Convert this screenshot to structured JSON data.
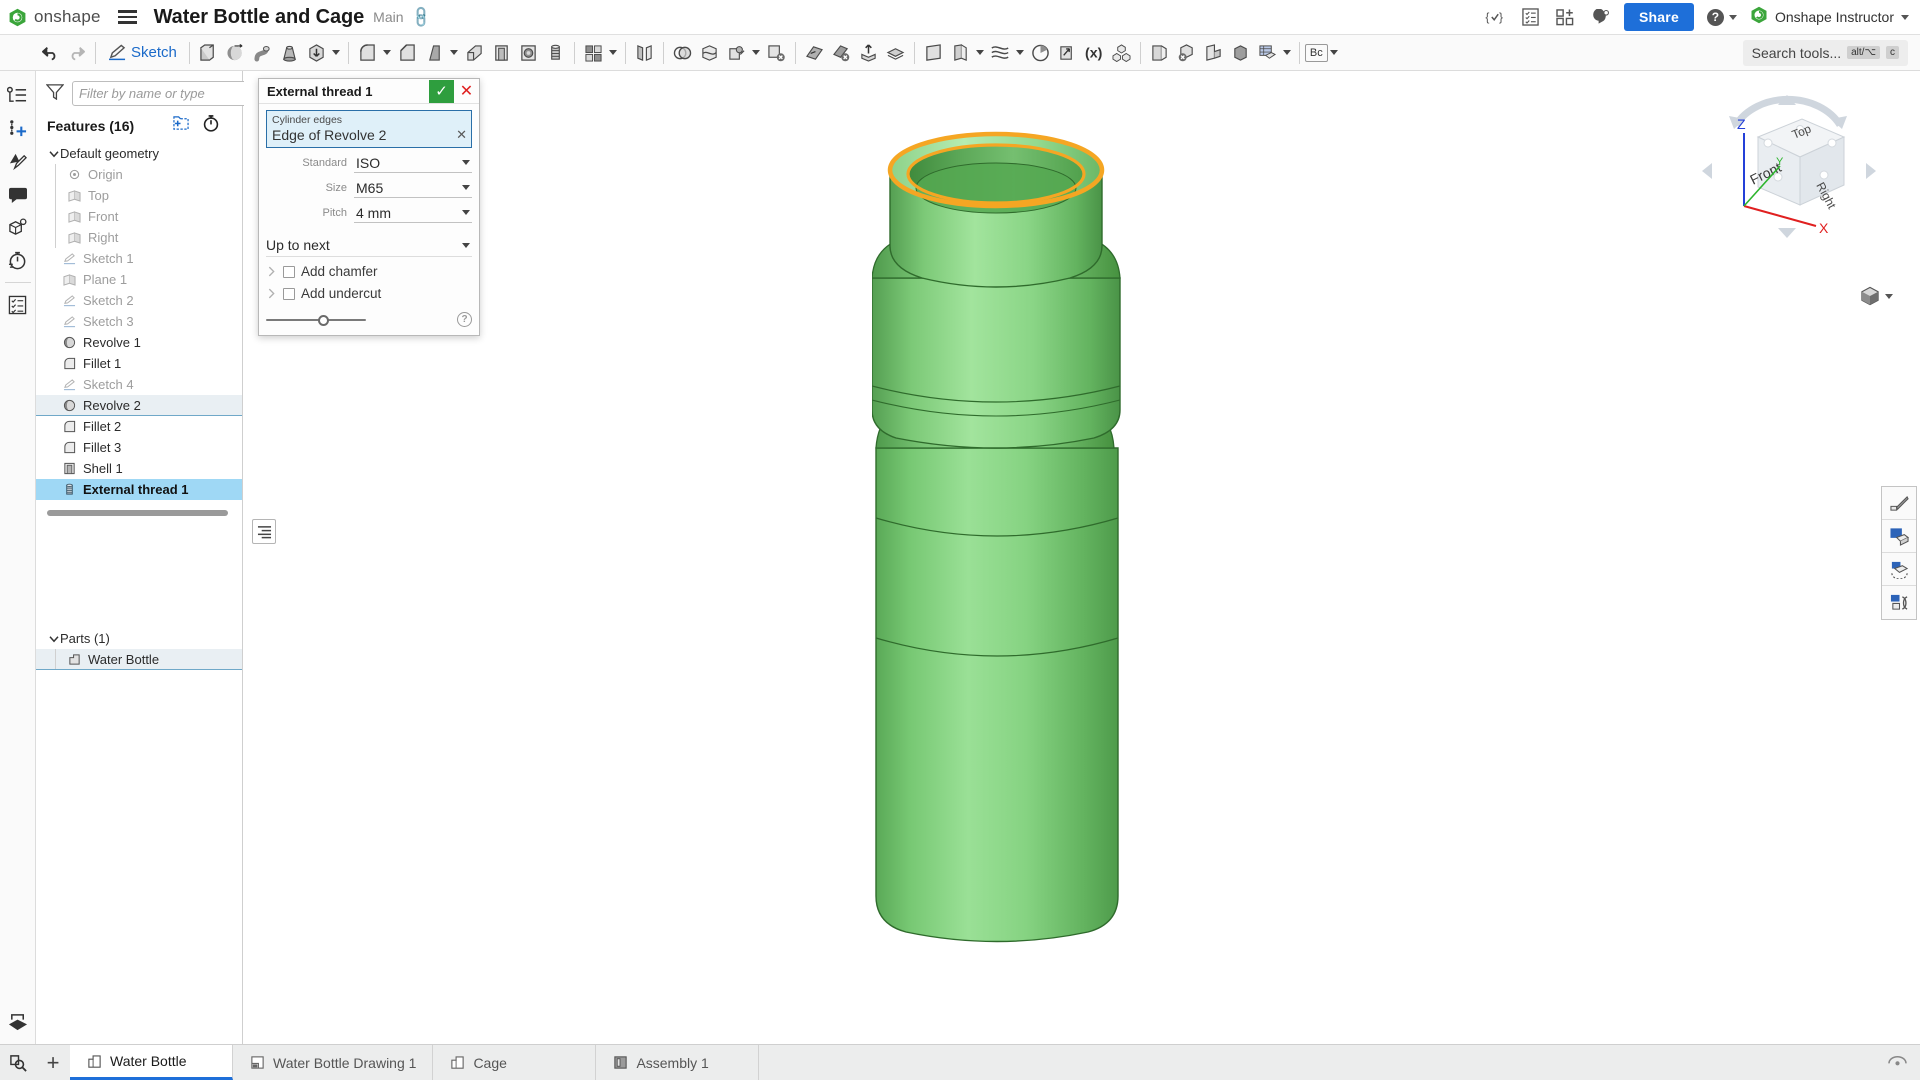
{
  "header": {
    "brand": "onshape",
    "doc_title": "Water Bottle and Cage",
    "branch": "Main",
    "share_label": "Share",
    "user_name": "Onshape Instructor",
    "icons": [
      "variable-studio-icon",
      "version-list-icon",
      "add-workspace-icon",
      "comments-ai-icon"
    ]
  },
  "toolbar": {
    "sketch_label": "Sketch",
    "search_placeholder": "Search tools...",
    "search_kbd_1": "alt/⌥",
    "search_kbd_2": "c",
    "bc_label": "Bc"
  },
  "tree": {
    "filter_placeholder": "Filter by name or type",
    "features_title": "Features (16)",
    "group_label": "Default geometry",
    "default_geometry": [
      {
        "label": "Origin",
        "icon": "origin-icon"
      },
      {
        "label": "Top",
        "icon": "plane-icon"
      },
      {
        "label": "Front",
        "icon": "plane-icon"
      },
      {
        "label": "Right",
        "icon": "plane-icon"
      }
    ],
    "features": [
      {
        "label": "Sketch 1",
        "icon": "sketch-icon",
        "state": "muted"
      },
      {
        "label": "Plane 1",
        "icon": "plane-icon",
        "state": "muted"
      },
      {
        "label": "Sketch 2",
        "icon": "sketch-icon",
        "state": "muted"
      },
      {
        "label": "Sketch 3",
        "icon": "sketch-icon",
        "state": "muted"
      },
      {
        "label": "Revolve 1",
        "icon": "revolve-icon",
        "state": "normal"
      },
      {
        "label": "Fillet 1",
        "icon": "fillet-icon",
        "state": "normal"
      },
      {
        "label": "Sketch 4",
        "icon": "sketch-icon",
        "state": "muted"
      },
      {
        "label": "Revolve 2",
        "icon": "revolve-icon",
        "state": "sel-light"
      },
      {
        "label": "Fillet 2",
        "icon": "fillet-icon",
        "state": "normal"
      },
      {
        "label": "Fillet 3",
        "icon": "fillet-icon",
        "state": "normal"
      },
      {
        "label": "Shell 1",
        "icon": "shell-icon",
        "state": "normal"
      },
      {
        "label": "External thread 1",
        "icon": "thread-icon",
        "state": "sel-strong"
      }
    ],
    "parts_title": "Parts (1)",
    "parts": [
      {
        "label": "Water Bottle",
        "icon": "part-icon"
      }
    ]
  },
  "dialog": {
    "title": "External thread 1",
    "selection_label": "Cylinder edges",
    "selection_value": "Edge of Revolve 2",
    "params": [
      {
        "label": "Standard",
        "value": "ISO"
      },
      {
        "label": "Size",
        "value": "M65"
      },
      {
        "label": "Pitch",
        "value": "4 mm"
      }
    ],
    "end_condition": "Up to next",
    "checkboxes": [
      {
        "label": "Add chamfer",
        "checked": false
      },
      {
        "label": "Add undercut",
        "checked": false
      }
    ],
    "help_glyph": "?",
    "ok_glyph": "✓",
    "cancel_glyph": "✕"
  },
  "viewcube": {
    "top": "Top",
    "front": "Front",
    "right": "Right",
    "axis_x": "X",
    "axis_y": "Y",
    "axis_z": "Z",
    "axis_x_color": "#e02020",
    "axis_y_color": "#2db52d",
    "axis_z_color": "#2440d8"
  },
  "model": {
    "body_color": "#7ed07a",
    "highlight_edge_color": "#f5a623",
    "name": "Water Bottle"
  },
  "tabs": [
    {
      "label": "Water Bottle",
      "icon": "part-studio-icon",
      "active": true
    },
    {
      "label": "Water Bottle Drawing 1",
      "icon": "drawing-icon",
      "active": false
    },
    {
      "label": "Cage",
      "icon": "part-studio-icon",
      "active": false
    },
    {
      "label": "Assembly 1",
      "icon": "assembly-icon",
      "active": false
    }
  ]
}
